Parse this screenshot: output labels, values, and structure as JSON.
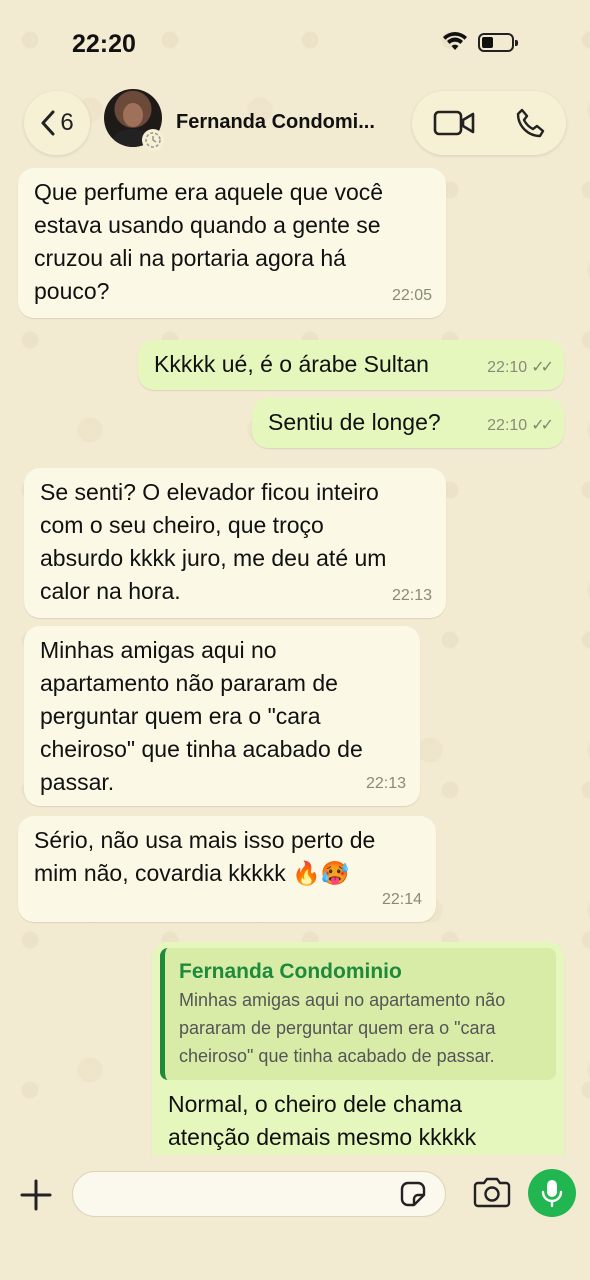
{
  "status": {
    "time": "22:20"
  },
  "header": {
    "back_count": "6",
    "contact_name": "Fernanda Condomi..."
  },
  "messages": [
    {
      "text": "Que perfume era aquele que você\nestava usando quando a gente se\ncruzou ali na portaria agora há\npouco?",
      "time": "22:05"
    },
    {
      "text": "Kkkkk ué, é o árabe Sultan",
      "time": "22:10"
    },
    {
      "text": "Sentiu de longe?",
      "time": "22:10"
    },
    {
      "text": "Se senti? O elevador ficou inteiro\ncom o seu cheiro, que troço\nabsurdo kkkk juro, me deu até um\ncalor na hora.",
      "time": "22:13"
    },
    {
      "text": "Minhas amigas aqui no\napartamento não pararam de\nperguntar quem era o \"cara\ncheiroso\" que tinha acabado de\npassar.",
      "time": "22:13"
    },
    {
      "text": "Sério, não usa mais isso perto de\nmim não, covardia kkkkk 🔥🥵",
      "time": "22:14"
    },
    {
      "quote_name": "Fernanda Condominio",
      "quote_text": "Minhas amigas aqui no apartamento não\npararam de perguntar quem era o \"cara\ncheiroso\" que tinha acabado de passar.",
      "text": "Normal, o cheiro dele chama\natenção demais mesmo kkkkk"
    }
  ],
  "colors": {
    "incoming": "#fbf8e6",
    "outgoing": "#e5f7bd",
    "accent": "#21b650"
  },
  "icons": [
    "wifi-icon",
    "battery-icon",
    "chevron-left-icon",
    "video-call-icon",
    "phone-icon",
    "plus-icon",
    "sticker-icon",
    "camera-icon",
    "mic-icon",
    "double-check-icon"
  ]
}
